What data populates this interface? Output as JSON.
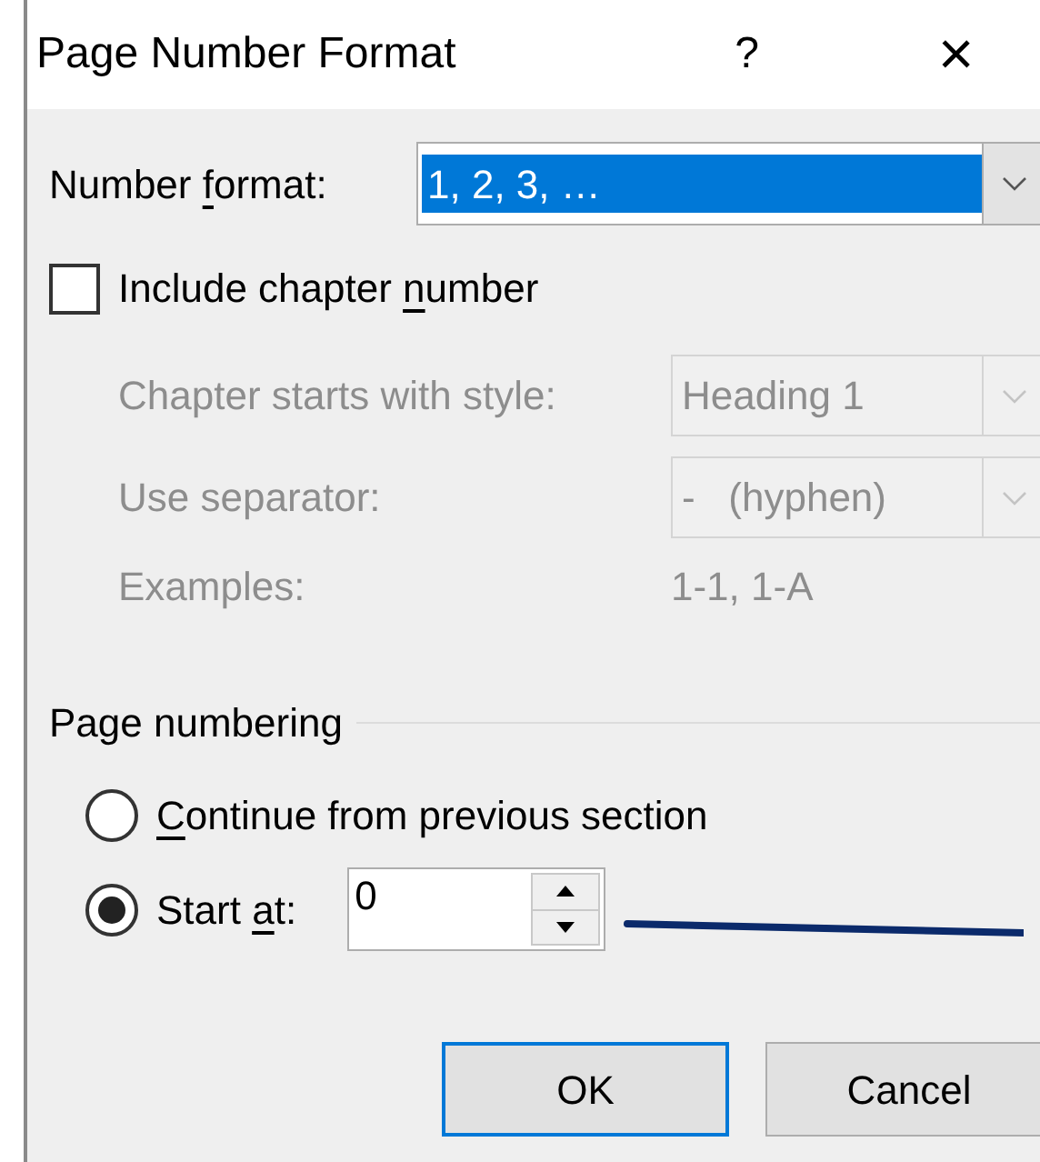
{
  "window": {
    "title": "Page Number Format",
    "help": "?",
    "close": "×"
  },
  "number_format": {
    "label_parts": {
      "before": "Number ",
      "key": "f",
      "after": "ormat:"
    },
    "value": "1, 2, 3, …"
  },
  "include_chapter": {
    "label_parts": {
      "before": "Include chapter ",
      "key": "n",
      "after": "umber"
    },
    "checked": false
  },
  "chapter": {
    "disabled": true,
    "style": {
      "label": "Chapter starts with style:",
      "value": "Heading 1"
    },
    "separator": {
      "label": "Use separator:",
      "value": "-   (hyphen)"
    },
    "examples": {
      "label": "Examples:",
      "value": "1-1, 1-A"
    }
  },
  "page_numbering": {
    "title": "Page numbering",
    "options": [
      {
        "kind": "plain",
        "label_parts": {
          "key": "C",
          "after": "ontinue from previous section"
        },
        "selected": false
      },
      {
        "kind": "spinner",
        "label_parts": {
          "before": "Start ",
          "key": "a",
          "after": "t:"
        },
        "selected": true,
        "value": "0"
      }
    ]
  },
  "buttons": [
    {
      "label": "OK",
      "default": true
    },
    {
      "label": "Cancel",
      "default": false
    }
  ]
}
